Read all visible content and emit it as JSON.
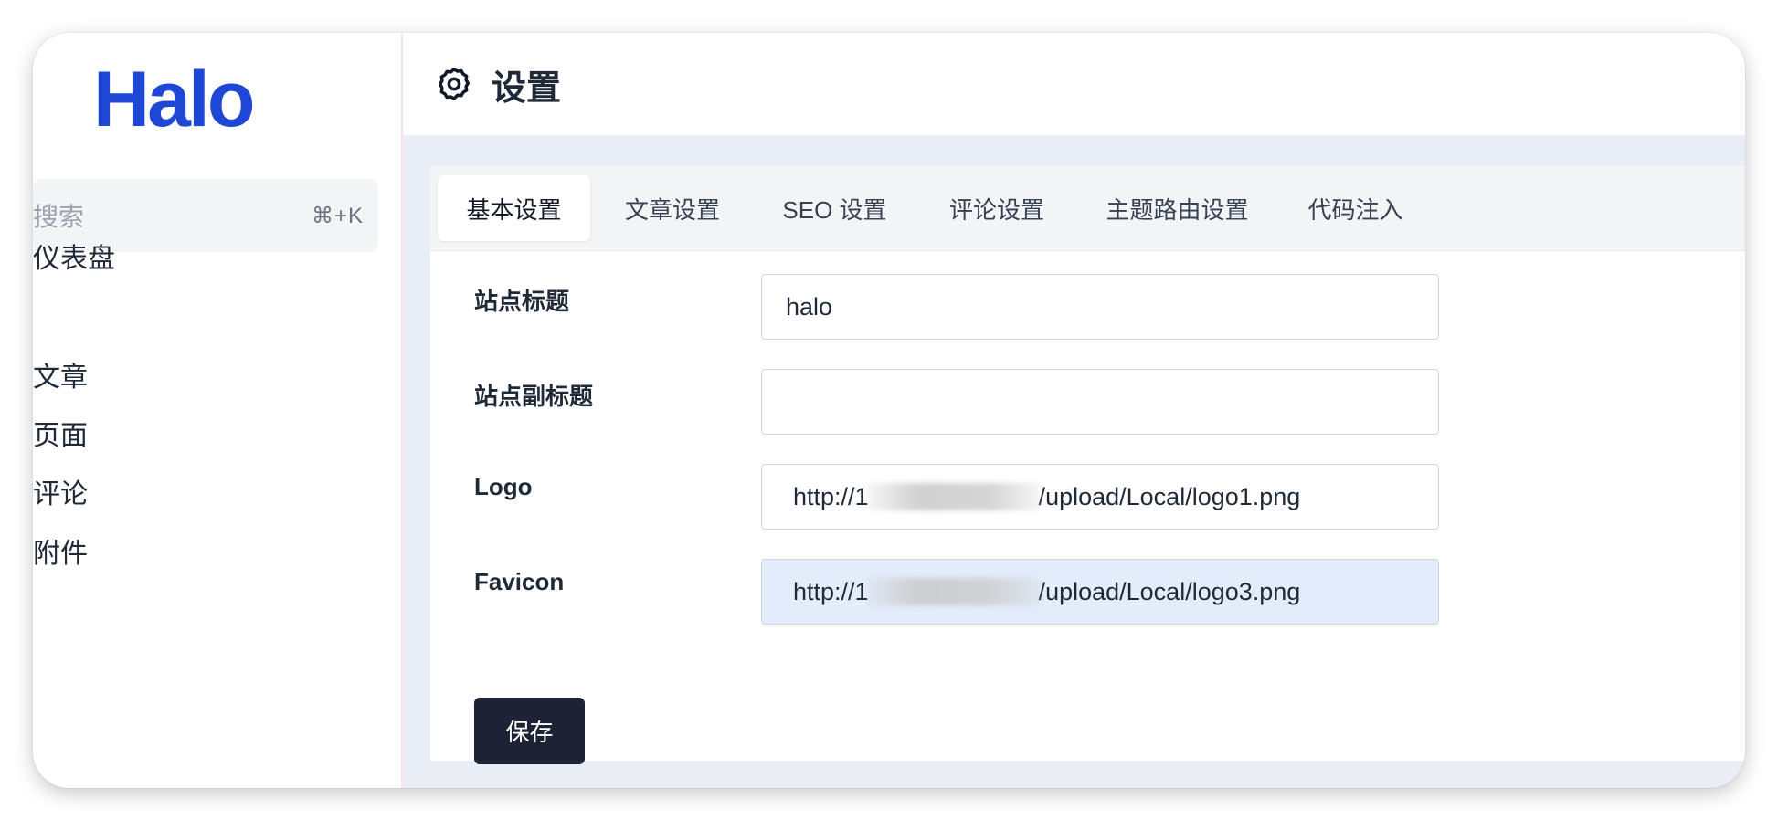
{
  "brand": {
    "logo_text": "Halo"
  },
  "sidebar": {
    "search": {
      "placeholder": "搜索",
      "shortcut": "⌘+K"
    },
    "items": [
      {
        "label": "仪表盘"
      },
      {
        "label": "文章"
      },
      {
        "label": "页面"
      },
      {
        "label": "评论"
      },
      {
        "label": "附件"
      }
    ]
  },
  "header": {
    "title": "设置",
    "icon": "gear-icon"
  },
  "tabs": [
    {
      "label": "基本设置",
      "active": true
    },
    {
      "label": "文章设置",
      "active": false
    },
    {
      "label": "SEO 设置",
      "active": false
    },
    {
      "label": "评论设置",
      "active": false
    },
    {
      "label": "主题路由设置",
      "active": false
    },
    {
      "label": "代码注入",
      "active": false
    }
  ],
  "form": {
    "site_title": {
      "label": "站点标题",
      "value": "halo"
    },
    "site_subtitle": {
      "label": "站点副标题",
      "value": ""
    },
    "logo": {
      "label": "Logo",
      "value_prefix": "http://1",
      "value_suffix": "/upload/Local/logo1.png"
    },
    "favicon": {
      "label": "Favicon",
      "value_prefix": "http://1",
      "value_suffix": "/upload/Local/logo3.png"
    },
    "save_label": "保存"
  },
  "colors": {
    "brand": "#1f47d6",
    "content_bg": "#e8edf6",
    "save_button": "#1e2235",
    "autofill_field": "#e3ecfb"
  }
}
